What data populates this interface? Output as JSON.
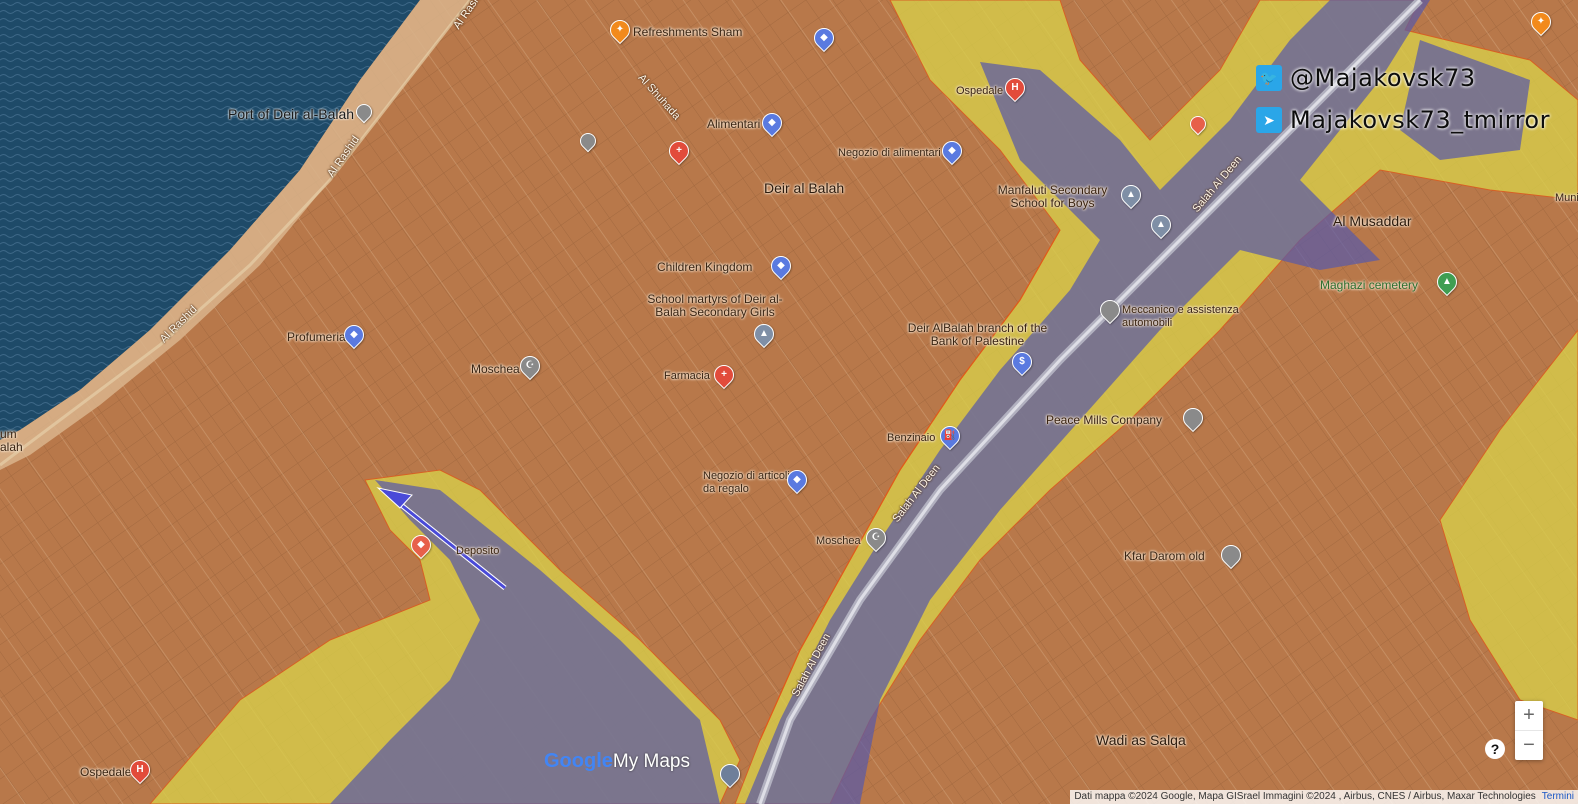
{
  "social": {
    "twitter_handle": "@Majakovsk73",
    "telegram_handle": "Majakovsk73_tmirror"
  },
  "places": {
    "refreshments_sham": "Refreshments Sham",
    "port_deir_al_balah": "Port of Deir al-Balah",
    "alimentari": "Alimentari",
    "negozio_alimentari": "Negozio di alimentari",
    "deir_al_balah": "Deir al Balah",
    "ospedale_top": "Ospedale",
    "manfaluti_school": "Manfaluti Secondary School for Boys",
    "children_kingdom": "Children Kingdom",
    "school_martyrs": "School martyrs of Deir al-Balah Secondary Girls",
    "profumeria": "Profumeria",
    "moschea_left": "Moschea",
    "farmacia": "Farmacia",
    "bank_palestine": "Deir AlBalah branch of the Bank of Palestine",
    "meccanico": "Meccanico e assistenza automobili",
    "al_musaddar": "Al Musaddar",
    "maghazi_cemetery": "Maghazi cemetery",
    "peace_mills": "Peace Mills Company",
    "benzinaio": "Benzinaio",
    "negozio_regalo": "Negozio di articoli da regalo",
    "moschea_right": "Moschea",
    "deposito": "Deposito",
    "kfar_darom": "Kfar Darom old",
    "wadi_as_salqa": "Wadi as Salqa",
    "ospedale_bottom": "Ospedale",
    "edge_left": "um alah",
    "edge_right": "Muni"
  },
  "roads": {
    "al_rashid_1": "Al Rashid",
    "al_rashid_2": "Al Rashid",
    "al_rashid_3": "Al Rashid",
    "al_shuhada": "Al Shuhada",
    "salah_al_deen_1": "Salah Al Deen",
    "salah_al_deen_2": "Salah Al Deen",
    "salah_al_deen_3": "Salah Al Deen"
  },
  "controls": {
    "zoom_in": "+",
    "zoom_out": "−",
    "help": "?"
  },
  "branding": {
    "logo_google": "Google",
    "logo_mymaps": "My Maps"
  },
  "attribution": {
    "text": "Dati mappa ©2024 Google, Mapa GISrael Immagini ©2024 , Airbus, CNES / Airbus, Maxar Technologies",
    "terms": "Termini"
  },
  "colors": {
    "sea": "#1e4a68",
    "urban_overlay": "#c07848",
    "yellow_zone": "#d9d04a",
    "blue_zone": "#5a5aa8",
    "advance_arrow": "#4a4ad8"
  }
}
